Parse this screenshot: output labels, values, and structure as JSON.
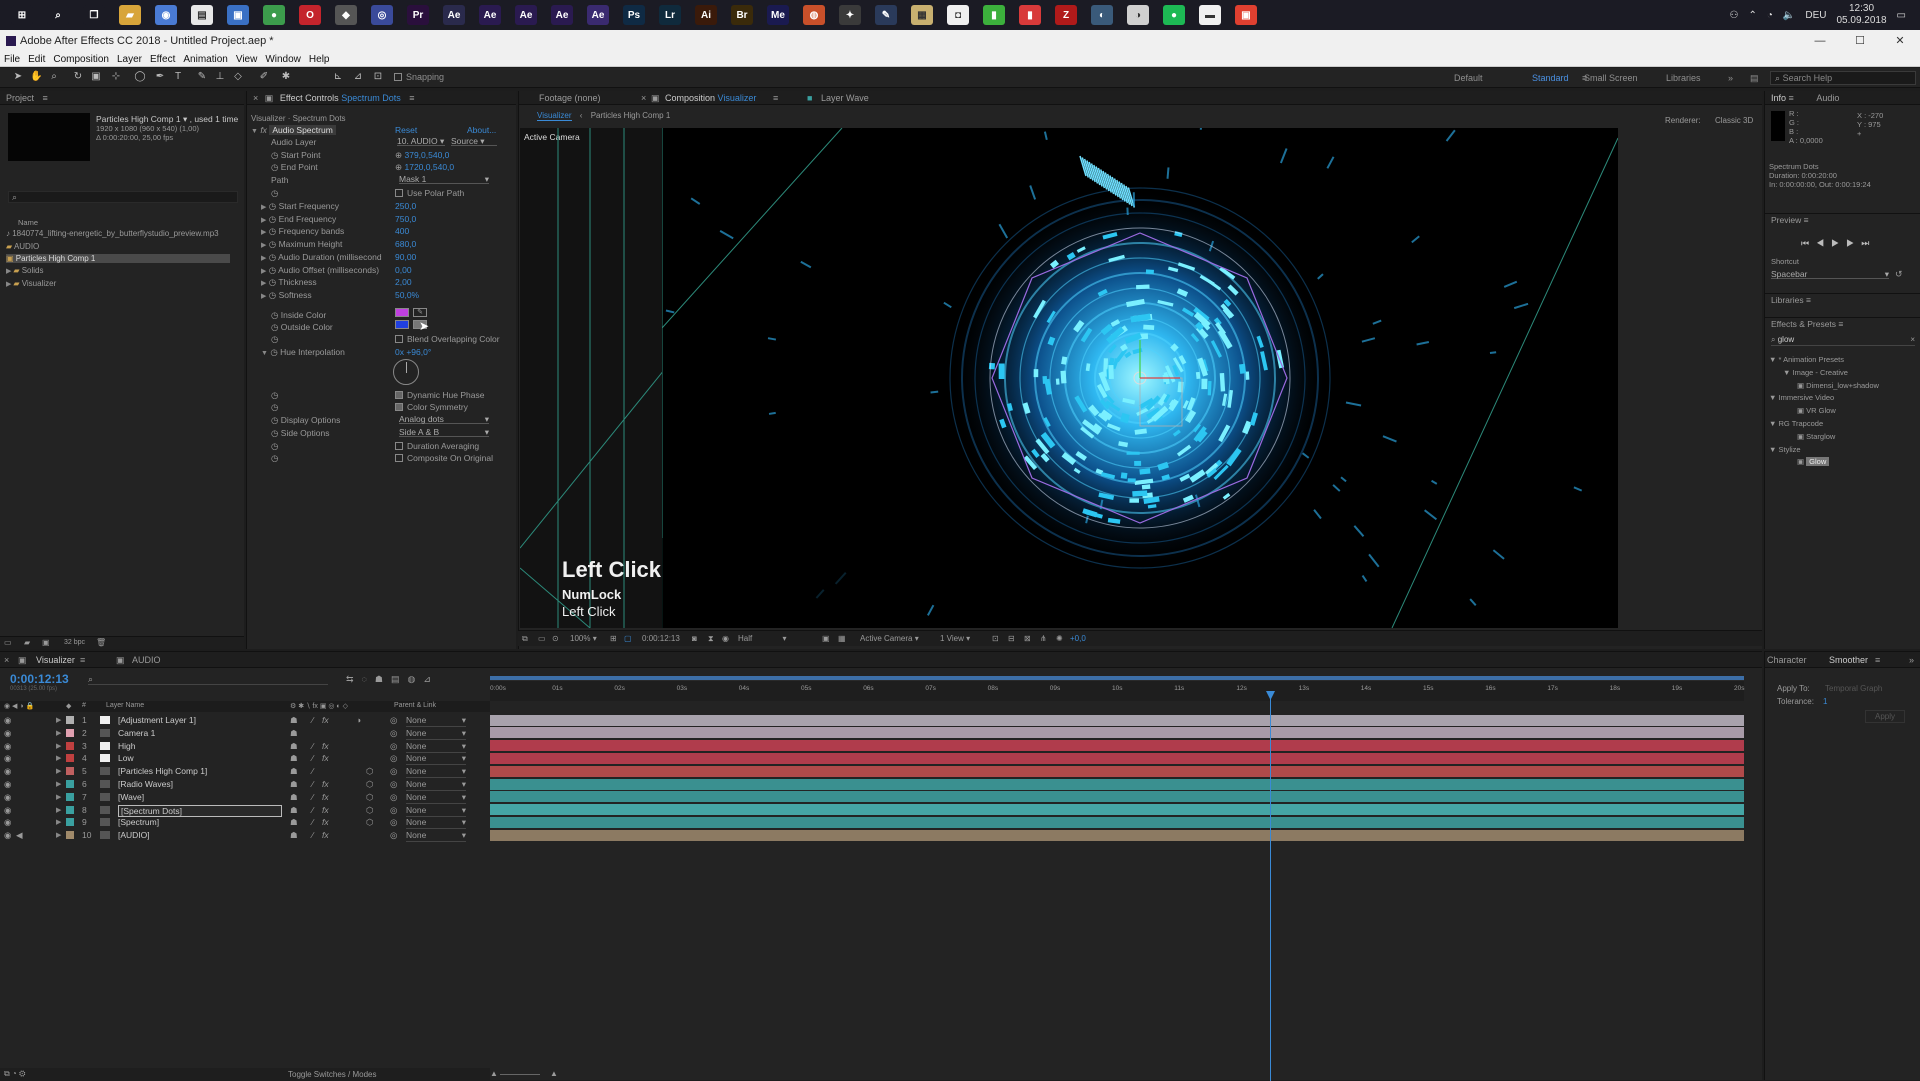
{
  "taskbar": {
    "icons": [
      {
        "name": "windows-start-icon",
        "glyph": "⊞",
        "color": "#1b1b24"
      },
      {
        "name": "search-icon",
        "glyph": "⌕",
        "color": "#1b1b24"
      },
      {
        "name": "task-view-icon",
        "glyph": "❐",
        "color": "#1b1b24"
      },
      {
        "name": "file-explorer-icon",
        "glyph": "▰",
        "color": "#d8a53a"
      },
      {
        "name": "app-icon-2",
        "glyph": "◉",
        "color": "#4a7bd4"
      },
      {
        "name": "notepad-icon",
        "glyph": "▤",
        "color": "#e8e8e8"
      },
      {
        "name": "store-icon",
        "glyph": "▣",
        "color": "#3a70c4"
      },
      {
        "name": "chrome-icon",
        "glyph": "●",
        "color": "#3c9c4c"
      },
      {
        "name": "opera-icon",
        "glyph": "O",
        "color": "#c4242c"
      },
      {
        "name": "app-icon-9",
        "glyph": "◆",
        "color": "#555"
      },
      {
        "name": "app-icon-10",
        "glyph": "◎",
        "color": "#3a4a9a"
      },
      {
        "name": "premiere-icon",
        "glyph": "Pr",
        "color": "#2a0f3c"
      },
      {
        "name": "animate-icon",
        "glyph": "Ae",
        "color": "#2a2a4c"
      },
      {
        "name": "after-effects-icon",
        "glyph": "Ae",
        "color": "#2a1a50"
      },
      {
        "name": "after-effects-icon-2",
        "glyph": "Ae",
        "color": "#2a1a50"
      },
      {
        "name": "after-effects-icon-3",
        "glyph": "Ae",
        "color": "#2a1a50"
      },
      {
        "name": "after-effects-icon-active",
        "glyph": "Ae",
        "color": "#3a2a70"
      },
      {
        "name": "photoshop-icon",
        "glyph": "Ps",
        "color": "#0f2a44"
      },
      {
        "name": "lightroom-icon",
        "glyph": "Lr",
        "color": "#0f2a3c"
      },
      {
        "name": "illustrator-icon",
        "glyph": "Ai",
        "color": "#3a1a0a"
      },
      {
        "name": "bridge-icon",
        "glyph": "Br",
        "color": "#3a2a0a"
      },
      {
        "name": "media-encoder-icon",
        "glyph": "Me",
        "color": "#1a1a50"
      },
      {
        "name": "houdini-icon",
        "glyph": "◍",
        "color": "#c8502a"
      },
      {
        "name": "app-icon-23",
        "glyph": "✦",
        "color": "#3a3a3a"
      },
      {
        "name": "app-icon-24",
        "glyph": "✎",
        "color": "#2a3a5a"
      },
      {
        "name": "app-icon-25",
        "glyph": "▦",
        "color": "#c8b070"
      },
      {
        "name": "app-icon-26",
        "glyph": "◘",
        "color": "#f0f0f0"
      },
      {
        "name": "app-icon-27",
        "glyph": "▮",
        "color": "#3cb03c"
      },
      {
        "name": "app-icon-28",
        "glyph": "▮",
        "color": "#d83a3a"
      },
      {
        "name": "filezilla-icon",
        "glyph": "Z",
        "color": "#b01a1a"
      },
      {
        "name": "app-icon-30",
        "glyph": "◐",
        "color": "#3a5a7a"
      },
      {
        "name": "app-icon-31",
        "glyph": "◑",
        "color": "#d0d0d0"
      },
      {
        "name": "spotify-icon",
        "glyph": "●",
        "color": "#1db954"
      },
      {
        "name": "app-icon-33",
        "glyph": "▬",
        "color": "#f0f0f0"
      },
      {
        "name": "app-icon-34",
        "glyph": "▣",
        "color": "#e04030"
      }
    ],
    "language": "DEU",
    "time": "12:30",
    "date": "05.09.2018"
  },
  "window": {
    "title": "Adobe After Effects CC 2018 - Untitled Project.aep *"
  },
  "menu": [
    "File",
    "Edit",
    "Composition",
    "Layer",
    "Effect",
    "Animation",
    "View",
    "Window",
    "Help"
  ],
  "toolbar": {
    "snapping": "Snapping",
    "workspaces": [
      "Default",
      "Standard",
      "Small Screen",
      "Libraries"
    ],
    "search_placeholder": "Search Help"
  },
  "project": {
    "tab": "Project",
    "comp_name": "Particles High Comp 1",
    "used": ", used 1 time",
    "info1": "1920 x 1080 (960 x 540) (1,00)",
    "info2": "Δ 0:00:20:00, 25,00 fps",
    "col_name": "Name",
    "items": [
      "1840774_lifting-energetic_by_butterflystudio_preview.mp3",
      "AUDIO",
      "Particles High Comp 1",
      "Solids",
      "Visualizer"
    ],
    "bpc": "32 bpc"
  },
  "effect_controls": {
    "tab": "Effect Controls",
    "tab_layer": "Spectrum Dots",
    "breadcrumb": "Visualizer · Spectrum Dots",
    "effect_name": "Audio Spectrum",
    "reset": "Reset",
    "about": "About...",
    "props": {
      "audio_layer": "Audio Layer",
      "audio_layer_val": "10. AUDIO",
      "audio_source": "Source",
      "start_point": "Start Point",
      "start_point_val": "379,0,540,0",
      "end_point": "End Point",
      "end_point_val": "1720,0,540,0",
      "path": "Path",
      "path_val": "Mask 1",
      "use_polar": "Use Polar Path",
      "start_freq": "Start Frequency",
      "start_freq_val": "250,0",
      "end_freq": "End Frequency",
      "end_freq_val": "750,0",
      "freq_bands": "Frequency bands",
      "freq_bands_val": "400",
      "max_height": "Maximum Height",
      "max_height_val": "680,0",
      "audio_duration": "Audio Duration (millisecond",
      "audio_duration_val": "90,00",
      "audio_offset": "Audio Offset (milliseconds)",
      "audio_offset_val": "0,00",
      "thickness": "Thickness",
      "thickness_val": "2,00",
      "softness": "Softness",
      "softness_val": "50,0%",
      "inside_color": "Inside Color",
      "outside_color": "Outside Color",
      "blend": "Blend Overlapping Color",
      "hue": "Hue Interpolation",
      "hue_val": "0x +96,0°",
      "dynamic_hue": "Dynamic Hue Phase",
      "color_symmetry": "Color Symmetry",
      "display_options": "Display Options",
      "display_options_val": "Analog dots",
      "side_options": "Side Options",
      "side_options_val": "Side A & B",
      "duration_avg": "Duration Averaging",
      "composite": "Composite On Original"
    }
  },
  "viewer": {
    "footage_tab": "Footage (none)",
    "comp_tab": "Composition",
    "comp_tab_name": "Visualizer",
    "layer_tab": "Layer",
    "layer_tab_name": "Wave",
    "crumb1": "Visualizer",
    "crumb2": "Particles High Comp 1",
    "renderer": "Renderer:",
    "renderer_val": "Classic 3D",
    "active_camera": "Active Camera",
    "zoom": "100%",
    "timecode": "0:00:12:13",
    "resolution": "Half",
    "camera": "Active Camera",
    "views": "1 View",
    "exposure": "+0,0"
  },
  "overlay": {
    "title": "Left Click",
    "line1": "NumLock",
    "line2": "Left Click"
  },
  "info_panel": {
    "tab": "Info",
    "tab2": "Audio",
    "r": "R :",
    "g": "G :",
    "b": "B :",
    "a": "A : 0,0000",
    "x": "X : -270",
    "y": "Y : 975",
    "layer": "Spectrum Dots",
    "duration": "Duration: 0:00:20:00",
    "inout": "In: 0:00:00:00, Out: 0:00:19:24"
  },
  "preview_panel": {
    "tab": "Preview",
    "shortcut_label": "Shortcut",
    "shortcut_val": "Spacebar"
  },
  "libraries_panel": {
    "tab": "Libraries"
  },
  "effects_panel": {
    "tab": "Effects & Presets",
    "search": "glow",
    "tree": [
      {
        "label": "▼ * Animation Presets",
        "indent": 0
      },
      {
        "label": "▼ Image - Creative",
        "indent": 1
      },
      {
        "label": "Dimensi_low+shadow",
        "indent": 2
      },
      {
        "label": "▼ Immersive Video",
        "indent": 0
      },
      {
        "label": "VR Glow",
        "indent": 2
      },
      {
        "label": "▼ RG Trapcode",
        "indent": 0
      },
      {
        "label": "Starglow",
        "indent": 2
      },
      {
        "label": "▼ Stylize",
        "indent": 0
      },
      {
        "label": "Glow",
        "indent": 2
      }
    ]
  },
  "timeline": {
    "tab": "Visualizer",
    "tab2": "AUDIO",
    "timecode": "0:00:12:13",
    "frames": "00313 (25.00 fps)",
    "col_layer": "Layer Name",
    "col_parent": "Parent & Link",
    "layers": [
      {
        "num": "1",
        "name": "[Adjustment Layer 1]",
        "color": "#b0b0b0",
        "bar": "#a8a2ac",
        "parent": "None"
      },
      {
        "num": "2",
        "name": "Camera 1",
        "color": "#e0a0b0",
        "bar": "#a89aa8",
        "parent": "None"
      },
      {
        "num": "3",
        "name": "High",
        "color": "#c04040",
        "bar": "#b03c4c",
        "parent": "None"
      },
      {
        "num": "4",
        "name": "Low",
        "color": "#c04040",
        "bar": "#b03c4c",
        "parent": "None"
      },
      {
        "num": "5",
        "name": "[Particles High Comp 1]",
        "color": "#c06060",
        "bar": "#b04a4a",
        "parent": "None"
      },
      {
        "num": "6",
        "name": "[Radio Waves]",
        "color": "#3aa0a0",
        "bar": "#3a9090",
        "parent": "None"
      },
      {
        "num": "7",
        "name": "[Wave]",
        "color": "#3aa0a0",
        "bar": "#3a9090",
        "parent": "None"
      },
      {
        "num": "8",
        "name": "[Spectrum Dots]",
        "color": "#3aa0a0",
        "bar": "#45a5a5",
        "parent": "None"
      },
      {
        "num": "9",
        "name": "[Spectrum]",
        "color": "#3aa0a0",
        "bar": "#3a9090",
        "parent": "None"
      },
      {
        "num": "10",
        "name": "[AUDIO]",
        "color": "#a08a6a",
        "bar": "#8c7a62",
        "parent": "None"
      }
    ],
    "ruler": [
      "0:00s",
      "01s",
      "02s",
      "03s",
      "04s",
      "05s",
      "06s",
      "07s",
      "08s",
      "09s",
      "10s",
      "11s",
      "12s",
      "13s",
      "14s",
      "15s",
      "16s",
      "17s",
      "18s",
      "19s",
      "20s"
    ],
    "playhead_fraction": 0.627,
    "footer": "Toggle Switches / Modes"
  },
  "smoother": {
    "tab1": "Character",
    "tab2": "Smoother",
    "apply_to": "Apply To:",
    "apply_to_val": "Temporal Graph",
    "tolerance": "Tolerance:",
    "tolerance_val": "1",
    "apply": "Apply"
  }
}
